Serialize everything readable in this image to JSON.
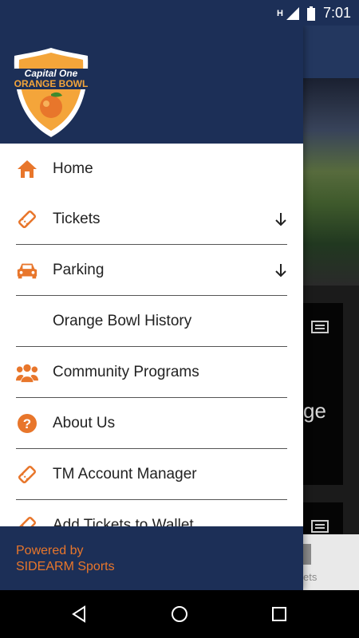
{
  "status_bar": {
    "network": "H",
    "time": "7:01"
  },
  "brand": {
    "logo_top": "Capital One",
    "logo_main": "ORANGE BOWL"
  },
  "colors": {
    "header_bg": "#1c2f57",
    "accent": "#e8762b",
    "text": "#222222"
  },
  "menu": {
    "items": [
      {
        "label": "Home",
        "icon": "home-icon",
        "has_chevron": false
      },
      {
        "label": "Tickets",
        "icon": "ticket-icon",
        "has_chevron": true
      },
      {
        "label": "Parking",
        "icon": "car-icon",
        "has_chevron": true
      },
      {
        "label": "Orange Bowl History",
        "icon": "",
        "has_chevron": false
      },
      {
        "label": "Community Programs",
        "icon": "people-icon",
        "has_chevron": false
      },
      {
        "label": "About Us",
        "icon": "question-icon",
        "has_chevron": false
      },
      {
        "label": "TM Account Manager",
        "icon": "ticket-icon",
        "has_chevron": false
      },
      {
        "label": "Add Tickets to Wallet",
        "icon": "ticket-icon",
        "has_chevron": false
      }
    ]
  },
  "footer": {
    "line1": "Powered by",
    "line2": "SIDEARM Sports"
  },
  "background": {
    "partial_word": "ge",
    "partial_tab": "ets"
  }
}
